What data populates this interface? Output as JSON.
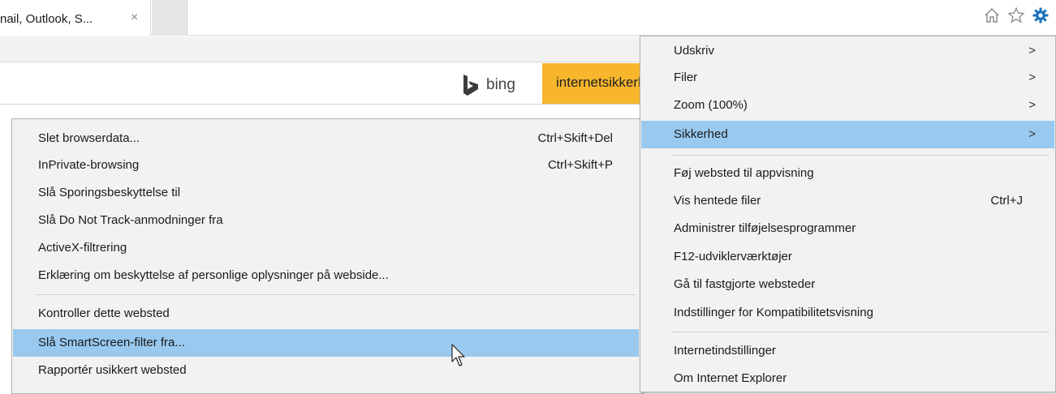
{
  "tab": {
    "title": "nail, Outlook, S...",
    "close": "×"
  },
  "toolbar": {
    "icons": [
      "home-icon",
      "favorites-star-icon",
      "settings-gear-icon"
    ]
  },
  "search": {
    "engine": "bing",
    "tag": "internetsikkerhed"
  },
  "colors": {
    "menu_bg": "#f2f2f2",
    "highlight": "#99c9ef",
    "bing_tag": "#f7b62c",
    "gear": "#1e73be"
  },
  "main_menu": {
    "items": [
      {
        "label": "Udskriv",
        "arrow": ">"
      },
      {
        "label": "Filer",
        "arrow": ">"
      },
      {
        "label": "Zoom (100%)",
        "arrow": ">"
      },
      {
        "label": "Sikkerhed",
        "arrow": ">"
      },
      {
        "label": "Føj websted til appvisning"
      },
      {
        "label": "Vis hentede filer",
        "shortcut": "Ctrl+J"
      },
      {
        "label": "Administrer tilføjelsesprogrammer"
      },
      {
        "label": "F12-udviklerværktøjer"
      },
      {
        "label": "Gå til fastgjorte websteder"
      },
      {
        "label": "Indstillinger for Kompatibilitetsvisning"
      },
      {
        "label": "Internetindstillinger"
      },
      {
        "label": "Om Internet Explorer"
      }
    ]
  },
  "security_menu": {
    "items": [
      {
        "label": "Slet browserdata...",
        "shortcut": "Ctrl+Skift+Del"
      },
      {
        "label": "InPrivate-browsing",
        "shortcut": "Ctrl+Skift+P"
      },
      {
        "label": "Slå Sporingsbeskyttelse til"
      },
      {
        "label": "Slå Do Not Track-anmodninger fra"
      },
      {
        "label": "ActiveX-filtrering"
      },
      {
        "label": "Erklæring om beskyttelse af personlige oplysninger på webside..."
      },
      {
        "label": "Kontroller dette websted"
      },
      {
        "label": "Slå SmartScreen-filter fra..."
      },
      {
        "label": "Rapportér usikkert websted"
      }
    ]
  }
}
